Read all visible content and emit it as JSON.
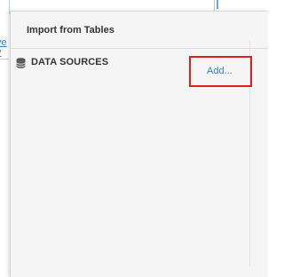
{
  "panel": {
    "title": "Import from Tables"
  },
  "data_sources": {
    "label": "DATA SOURCES",
    "icon": "database-icon",
    "add_label": "Add..."
  },
  "background": {
    "links": [
      "ve",
      "v"
    ]
  },
  "colors": {
    "panel_bg": "#f5f5f5",
    "link": "#2f7fc0",
    "highlight": "#e01f1f"
  }
}
